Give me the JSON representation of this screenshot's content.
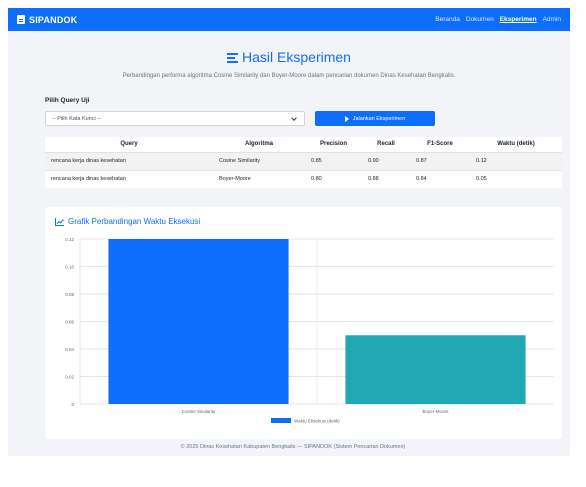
{
  "navbar": {
    "brand": "SIPANDOK",
    "links": [
      "Beranda",
      "Dokumen",
      "Eksperimen",
      "Admin"
    ],
    "active": "Eksperimen"
  },
  "page": {
    "title": "Hasil Eksperimen",
    "subtitle": "Perbandingan performa algoritma Cosine Similarity dan Boyer-Moore dalam pencarian dokumen Dinas Kesehatan Bengkalis."
  },
  "form": {
    "query_label": "Pilih Query Uji",
    "select_value": "-- Pilih Kata Kunci --",
    "run_button": "Jalankan Eksperimen"
  },
  "table": {
    "headers": [
      "Query",
      "Algoritma",
      "Precision",
      "Recall",
      "F1-Score",
      "Waktu (detik)"
    ],
    "rows": [
      [
        "rencana kerja dinas kesehatan",
        "Cosine Similarity",
        "0.85",
        "0.90",
        "0.87",
        "0.12"
      ],
      [
        "rencana kerja dinas kesehatan",
        "Boyer-Moore",
        "0.80",
        "0.88",
        "0.84",
        "0.05"
      ]
    ]
  },
  "chart_data": {
    "type": "bar",
    "title": "Grafik Perbandingan Waktu Eksekusi",
    "categories": [
      "Cosine Similarity",
      "Boyer-Moore"
    ],
    "series": [
      {
        "name": "Waktu Eksekusi (detik)",
        "values": [
          0.12,
          0.05
        ]
      }
    ],
    "colors": [
      "#0d6efd",
      "#20a8b4"
    ],
    "ylim": [
      0,
      0.12
    ],
    "yticks": [
      "0",
      "0.02",
      "0.04",
      "0.06",
      "0.08",
      "0.10",
      "0.12"
    ],
    "grid": true,
    "legend": "bottom"
  },
  "footer": "© 2025 Dinas Kesehatan Kabupaten Bengkalis — SIPANDOK (Sistem Pencarian Dokumen)"
}
